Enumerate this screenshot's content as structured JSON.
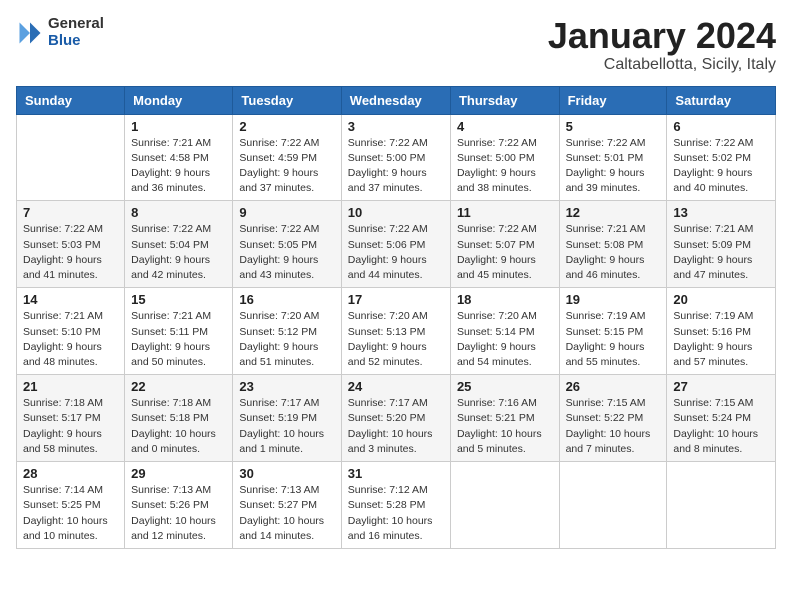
{
  "header": {
    "logo_general": "General",
    "logo_blue": "Blue",
    "month_title": "January 2024",
    "location": "Caltabellotta, Sicily, Italy"
  },
  "weekdays": [
    "Sunday",
    "Monday",
    "Tuesday",
    "Wednesday",
    "Thursday",
    "Friday",
    "Saturday"
  ],
  "weeks": [
    [
      {
        "day": "",
        "info": ""
      },
      {
        "day": "1",
        "info": "Sunrise: 7:21 AM\nSunset: 4:58 PM\nDaylight: 9 hours\nand 36 minutes."
      },
      {
        "day": "2",
        "info": "Sunrise: 7:22 AM\nSunset: 4:59 PM\nDaylight: 9 hours\nand 37 minutes."
      },
      {
        "day": "3",
        "info": "Sunrise: 7:22 AM\nSunset: 5:00 PM\nDaylight: 9 hours\nand 37 minutes."
      },
      {
        "day": "4",
        "info": "Sunrise: 7:22 AM\nSunset: 5:00 PM\nDaylight: 9 hours\nand 38 minutes."
      },
      {
        "day": "5",
        "info": "Sunrise: 7:22 AM\nSunset: 5:01 PM\nDaylight: 9 hours\nand 39 minutes."
      },
      {
        "day": "6",
        "info": "Sunrise: 7:22 AM\nSunset: 5:02 PM\nDaylight: 9 hours\nand 40 minutes."
      }
    ],
    [
      {
        "day": "7",
        "info": "Sunrise: 7:22 AM\nSunset: 5:03 PM\nDaylight: 9 hours\nand 41 minutes."
      },
      {
        "day": "8",
        "info": "Sunrise: 7:22 AM\nSunset: 5:04 PM\nDaylight: 9 hours\nand 42 minutes."
      },
      {
        "day": "9",
        "info": "Sunrise: 7:22 AM\nSunset: 5:05 PM\nDaylight: 9 hours\nand 43 minutes."
      },
      {
        "day": "10",
        "info": "Sunrise: 7:22 AM\nSunset: 5:06 PM\nDaylight: 9 hours\nand 44 minutes."
      },
      {
        "day": "11",
        "info": "Sunrise: 7:22 AM\nSunset: 5:07 PM\nDaylight: 9 hours\nand 45 minutes."
      },
      {
        "day": "12",
        "info": "Sunrise: 7:21 AM\nSunset: 5:08 PM\nDaylight: 9 hours\nand 46 minutes."
      },
      {
        "day": "13",
        "info": "Sunrise: 7:21 AM\nSunset: 5:09 PM\nDaylight: 9 hours\nand 47 minutes."
      }
    ],
    [
      {
        "day": "14",
        "info": "Sunrise: 7:21 AM\nSunset: 5:10 PM\nDaylight: 9 hours\nand 48 minutes."
      },
      {
        "day": "15",
        "info": "Sunrise: 7:21 AM\nSunset: 5:11 PM\nDaylight: 9 hours\nand 50 minutes."
      },
      {
        "day": "16",
        "info": "Sunrise: 7:20 AM\nSunset: 5:12 PM\nDaylight: 9 hours\nand 51 minutes."
      },
      {
        "day": "17",
        "info": "Sunrise: 7:20 AM\nSunset: 5:13 PM\nDaylight: 9 hours\nand 52 minutes."
      },
      {
        "day": "18",
        "info": "Sunrise: 7:20 AM\nSunset: 5:14 PM\nDaylight: 9 hours\nand 54 minutes."
      },
      {
        "day": "19",
        "info": "Sunrise: 7:19 AM\nSunset: 5:15 PM\nDaylight: 9 hours\nand 55 minutes."
      },
      {
        "day": "20",
        "info": "Sunrise: 7:19 AM\nSunset: 5:16 PM\nDaylight: 9 hours\nand 57 minutes."
      }
    ],
    [
      {
        "day": "21",
        "info": "Sunrise: 7:18 AM\nSunset: 5:17 PM\nDaylight: 9 hours\nand 58 minutes."
      },
      {
        "day": "22",
        "info": "Sunrise: 7:18 AM\nSunset: 5:18 PM\nDaylight: 10 hours\nand 0 minutes."
      },
      {
        "day": "23",
        "info": "Sunrise: 7:17 AM\nSunset: 5:19 PM\nDaylight: 10 hours\nand 1 minute."
      },
      {
        "day": "24",
        "info": "Sunrise: 7:17 AM\nSunset: 5:20 PM\nDaylight: 10 hours\nand 3 minutes."
      },
      {
        "day": "25",
        "info": "Sunrise: 7:16 AM\nSunset: 5:21 PM\nDaylight: 10 hours\nand 5 minutes."
      },
      {
        "day": "26",
        "info": "Sunrise: 7:15 AM\nSunset: 5:22 PM\nDaylight: 10 hours\nand 7 minutes."
      },
      {
        "day": "27",
        "info": "Sunrise: 7:15 AM\nSunset: 5:24 PM\nDaylight: 10 hours\nand 8 minutes."
      }
    ],
    [
      {
        "day": "28",
        "info": "Sunrise: 7:14 AM\nSunset: 5:25 PM\nDaylight: 10 hours\nand 10 minutes."
      },
      {
        "day": "29",
        "info": "Sunrise: 7:13 AM\nSunset: 5:26 PM\nDaylight: 10 hours\nand 12 minutes."
      },
      {
        "day": "30",
        "info": "Sunrise: 7:13 AM\nSunset: 5:27 PM\nDaylight: 10 hours\nand 14 minutes."
      },
      {
        "day": "31",
        "info": "Sunrise: 7:12 AM\nSunset: 5:28 PM\nDaylight: 10 hours\nand 16 minutes."
      },
      {
        "day": "",
        "info": ""
      },
      {
        "day": "",
        "info": ""
      },
      {
        "day": "",
        "info": ""
      }
    ]
  ]
}
